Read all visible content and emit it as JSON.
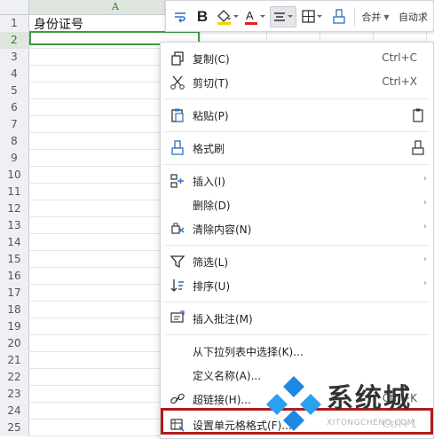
{
  "sheet": {
    "column_header": "A",
    "rows": [
      "1",
      "2",
      "3",
      "4",
      "5",
      "6",
      "7",
      "8",
      "9",
      "10",
      "11",
      "12",
      "13",
      "14",
      "15",
      "16",
      "17",
      "18",
      "19",
      "20",
      "21",
      "22",
      "23",
      "24",
      "25"
    ],
    "cell_a1": "身份证号"
  },
  "toolbar": {
    "merge_label": "合并",
    "autosum_label": "自动求",
    "icons": [
      "wrap-icon",
      "bold-icon",
      "fill-color-icon",
      "font-color-icon",
      "align-icon",
      "border-icon",
      "format-painter-icon"
    ]
  },
  "menu": {
    "copy": {
      "label": "复制(C)",
      "shortcut": "Ctrl+C"
    },
    "cut": {
      "label": "剪切(T)",
      "shortcut": "Ctrl+X"
    },
    "paste": {
      "label": "粘贴(P)"
    },
    "format_painter": {
      "label": "格式刷"
    },
    "insert": {
      "label": "插入(I)"
    },
    "delete": {
      "label": "删除(D)"
    },
    "clear": {
      "label": "清除内容(N)"
    },
    "filter": {
      "label": "筛选(L)"
    },
    "sort": {
      "label": "排序(U)"
    },
    "insert_comment": {
      "label": "插入批注(M)"
    },
    "pick_from_list": {
      "label": "从下拉列表中选择(K)..."
    },
    "define_name": {
      "label": "定义名称(A)..."
    },
    "hyperlink": {
      "label": "超链接(H)...",
      "shortcut": "Ctrl+K"
    },
    "format_cells": {
      "label": "设置单元格格式(F)...",
      "shortcut": "Ctrl+1"
    }
  },
  "watermark": {
    "title": "系统城",
    "subtitle": "XITONGCHENG.COM"
  },
  "colors": {
    "accent_green": "#3d9a42",
    "highlight_red": "#b01c1c",
    "icon_blue": "#2f6fc1"
  }
}
